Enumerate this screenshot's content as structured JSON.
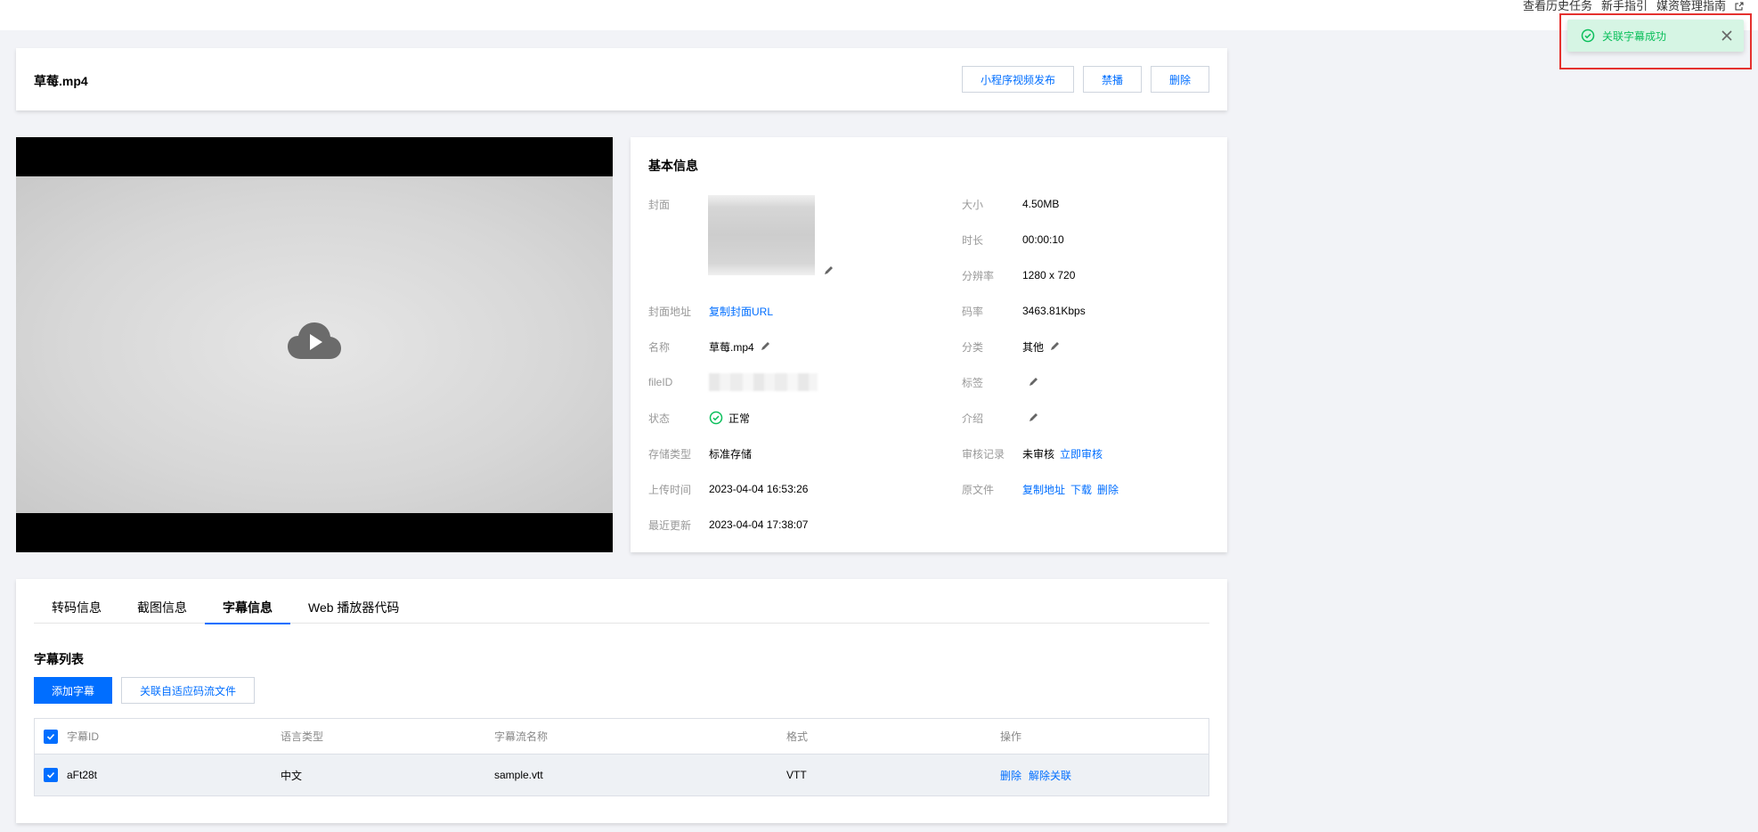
{
  "top_links": [
    "查看历史任务",
    "新手指引",
    "媒资管理指南"
  ],
  "toast": {
    "text": "关联字幕成功"
  },
  "header": {
    "file_name": "草莓.mp4",
    "actions": [
      "小程序视频发布",
      "禁播",
      "删除"
    ]
  },
  "info": {
    "title": "基本信息",
    "left": {
      "cover_label": "封面",
      "cover_url_label": "封面地址",
      "cover_url_link": "复制封面URL",
      "name_label": "名称",
      "name_value": "草莓.mp4",
      "fileid_label": "fileID",
      "status_label": "状态",
      "status_value": "正常",
      "storage_label": "存储类型",
      "storage_value": "标准存储",
      "upload_label": "上传时间",
      "upload_value": "2023-04-04 16:53:26",
      "updated_label": "最近更新",
      "updated_value": "2023-04-04 17:38:07"
    },
    "right": {
      "size_label": "大小",
      "size_value": "4.50MB",
      "duration_label": "时长",
      "duration_value": "00:00:10",
      "resolution_label": "分辨率",
      "resolution_value": "1280 x 720",
      "bitrate_label": "码率",
      "bitrate_value": "3463.81Kbps",
      "category_label": "分类",
      "category_value": "其他",
      "tag_label": "标签",
      "intro_label": "介绍",
      "review_label": "审核记录",
      "review_value": "未审核",
      "review_link": "立即审核",
      "source_label": "原文件",
      "source_links": [
        "复制地址",
        "下载",
        "删除"
      ]
    }
  },
  "tabs": [
    "转码信息",
    "截图信息",
    "字幕信息",
    "Web 播放器代码"
  ],
  "active_tab": 2,
  "subtitles": {
    "title": "字幕列表",
    "add_button": "添加字幕",
    "link_button": "关联自适应码流文件",
    "columns": [
      "字幕ID",
      "语言类型",
      "字幕流名称",
      "格式",
      "操作"
    ],
    "rows": [
      {
        "id": "aFt28t",
        "lang": "中文",
        "name": "sample.vtt",
        "format": "VTT",
        "ops": [
          "删除",
          "解除关联"
        ]
      }
    ]
  },
  "colors": {
    "accent": "#006eff",
    "success": "#0abf5b",
    "highlight": "#e5312e"
  }
}
